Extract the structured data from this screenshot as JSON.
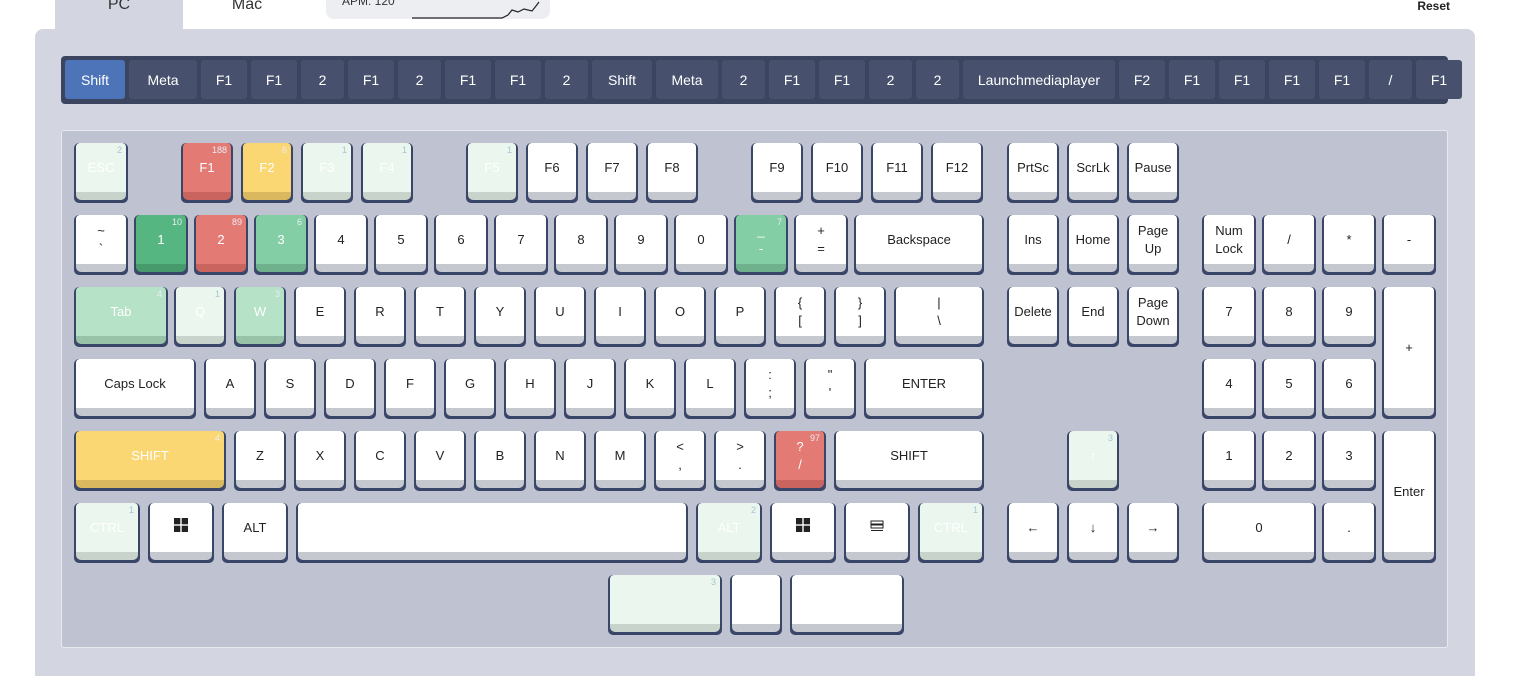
{
  "tabs": {
    "pc": "PC",
    "mac": "Mac"
  },
  "apm": {
    "label": "APM: 120"
  },
  "reset_label": "Reset",
  "history": [
    "Shift",
    "Meta",
    "F1",
    "F1",
    "2",
    "F1",
    "2",
    "F1",
    "F1",
    "2",
    "Shift",
    "Meta",
    "2",
    "F1",
    "F1",
    "2",
    "2",
    "Launchmediaplayer",
    "F2",
    "F1",
    "F1",
    "F1",
    "F1",
    "/",
    "F1"
  ],
  "keys": {
    "esc": {
      "label": "ESC",
      "count": "2"
    },
    "f1": {
      "label": "F1",
      "count": "188"
    },
    "f2": {
      "label": "F2",
      "count": "6"
    },
    "f3": {
      "label": "F3",
      "count": "1"
    },
    "f4": {
      "label": "F4",
      "count": "1"
    },
    "f5": {
      "label": "F5",
      "count": "1"
    },
    "f6": {
      "label": "F6"
    },
    "f7": {
      "label": "F7"
    },
    "f8": {
      "label": "F8"
    },
    "f9": {
      "label": "F9"
    },
    "f10": {
      "label": "F10"
    },
    "f11": {
      "label": "F11"
    },
    "f12": {
      "label": "F12"
    },
    "prtsc": {
      "label": "PrtSc"
    },
    "scrlk": {
      "label": "ScrLk"
    },
    "pause": {
      "label": "Pause"
    },
    "tilde": {
      "top": "~",
      "bottom": "`"
    },
    "d1": {
      "label": "1",
      "count": "10"
    },
    "d2": {
      "label": "2",
      "count": "89"
    },
    "d3": {
      "label": "3",
      "count": "6"
    },
    "d4": {
      "label": "4"
    },
    "d5": {
      "label": "5"
    },
    "d6": {
      "label": "6"
    },
    "d7": {
      "label": "7"
    },
    "d8": {
      "label": "8"
    },
    "d9": {
      "label": "9"
    },
    "d0": {
      "label": "0"
    },
    "minus": {
      "top": "_",
      "bottom": "-",
      "count": "7"
    },
    "equal": {
      "top": "+",
      "bottom": "="
    },
    "backspace": {
      "label": "Backspace"
    },
    "ins": {
      "label": "Ins"
    },
    "home": {
      "label": "Home"
    },
    "pgup": {
      "top": "Page",
      "bottom": "Up"
    },
    "numlock": {
      "top": "Num",
      "bottom": "Lock"
    },
    "numdiv": {
      "label": "/"
    },
    "nummul": {
      "label": "*"
    },
    "numsub": {
      "label": "-"
    },
    "tab": {
      "label": "Tab",
      "count": "4"
    },
    "q": {
      "label": "Q",
      "count": "1"
    },
    "w": {
      "label": "W",
      "count": "3"
    },
    "e": {
      "label": "E"
    },
    "r": {
      "label": "R"
    },
    "t": {
      "label": "T"
    },
    "y": {
      "label": "Y"
    },
    "u": {
      "label": "U"
    },
    "i": {
      "label": "I"
    },
    "o": {
      "label": "O"
    },
    "p": {
      "label": "P"
    },
    "lbracket": {
      "top": "{",
      "bottom": "["
    },
    "rbracket": {
      "top": "}",
      "bottom": "]"
    },
    "backslash": {
      "top": "|",
      "bottom": "\\"
    },
    "delete": {
      "label": "Delete"
    },
    "end": {
      "label": "End"
    },
    "pgdn": {
      "top": "Page",
      "bottom": "Down"
    },
    "num7": {
      "label": "7"
    },
    "num8": {
      "label": "8"
    },
    "num9": {
      "label": "9"
    },
    "numadd": {
      "label": "+"
    },
    "caps": {
      "label": "Caps Lock"
    },
    "a": {
      "label": "A"
    },
    "s": {
      "label": "S"
    },
    "d": {
      "label": "D"
    },
    "f": {
      "label": "F"
    },
    "g": {
      "label": "G"
    },
    "h": {
      "label": "H"
    },
    "j": {
      "label": "J"
    },
    "k": {
      "label": "K"
    },
    "l": {
      "label": "L"
    },
    "semicolon": {
      "top": ":",
      "bottom": ";"
    },
    "quote": {
      "top": "\"",
      "bottom": "'"
    },
    "enter": {
      "label": "ENTER"
    },
    "num4": {
      "label": "4"
    },
    "num5": {
      "label": "5"
    },
    "num6": {
      "label": "6"
    },
    "lshift": {
      "label": "SHIFT",
      "count": "4"
    },
    "z": {
      "label": "Z"
    },
    "x": {
      "label": "X"
    },
    "c": {
      "label": "C"
    },
    "v": {
      "label": "V"
    },
    "b": {
      "label": "B"
    },
    "n": {
      "label": "N"
    },
    "m": {
      "label": "M"
    },
    "comma": {
      "top": "<",
      "bottom": ","
    },
    "period": {
      "top": ">",
      "bottom": "."
    },
    "slash": {
      "top": "?",
      "bottom": "/",
      "count": "97"
    },
    "rshift": {
      "label": "SHIFT"
    },
    "up": {
      "label": "↑",
      "count": "3"
    },
    "num1": {
      "label": "1"
    },
    "num2": {
      "label": "2"
    },
    "num3": {
      "label": "3"
    },
    "numenter": {
      "label": "Enter"
    },
    "lctrl": {
      "label": "CTRL",
      "count": "1"
    },
    "lalt": {
      "label": "ALT"
    },
    "space": {
      "label": ""
    },
    "ralt": {
      "label": "ALT",
      "count": "2"
    },
    "rctrl": {
      "label": "CTRL",
      "count": "1"
    },
    "left": {
      "label": "←"
    },
    "down": {
      "label": "↓"
    },
    "right": {
      "label": "→"
    },
    "num0": {
      "label": "0"
    },
    "numdot": {
      "label": "."
    },
    "extra1": {
      "label": "",
      "count": "3"
    }
  }
}
